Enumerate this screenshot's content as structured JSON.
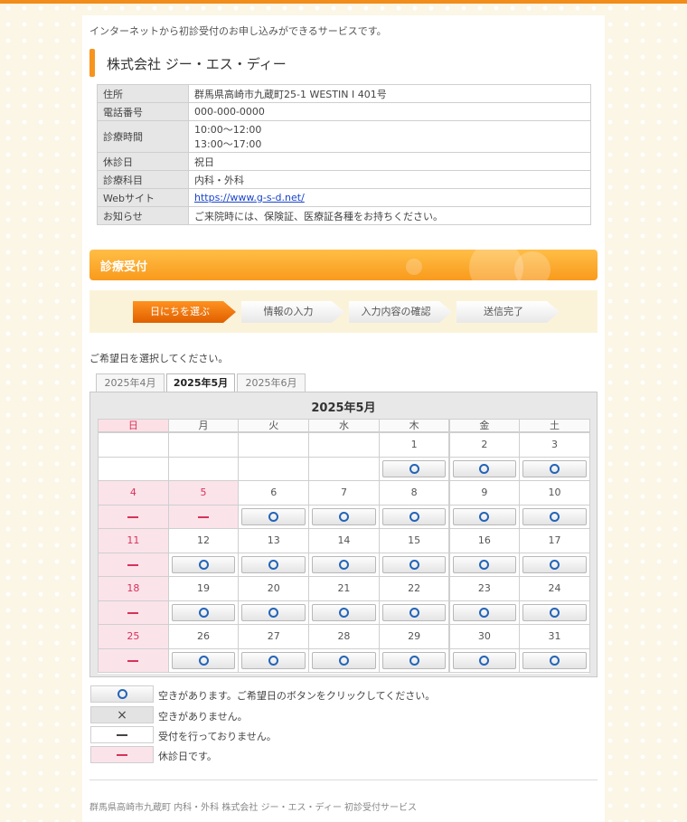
{
  "intro_text": "インターネットから初診受付のお申し込みができるサービスです。",
  "clinic": {
    "name": "株式会社 ジー・エス・ディー",
    "rows": [
      {
        "label": "住所",
        "value": "群馬県高崎市九蔵町25-1 WESTIN Ⅰ 401号"
      },
      {
        "label": "電話番号",
        "value": "000-000-0000"
      },
      {
        "label": "診療時間",
        "value": "10:00～12:00",
        "value2": "13:00～17:00"
      },
      {
        "label": "休診日",
        "value": "祝日"
      },
      {
        "label": "診療科目",
        "value": "内科・外科"
      },
      {
        "label": "Webサイト",
        "value": "https://www.g-s-d.net/"
      },
      {
        "label": "お知らせ",
        "value": "ご来院時には、保険証、医療証各種をお持ちください。"
      }
    ]
  },
  "section_title": "診療受付",
  "steps": [
    "日にちを選ぶ",
    "情報の入力",
    "入力内容の確認",
    "送信完了"
  ],
  "prompt": "ご希望日を選択してください。",
  "tabs": [
    "2025年4月",
    "2025年5月",
    "2025年6月"
  ],
  "calendar": {
    "title": "2025年5月",
    "weekdays": [
      "日",
      "月",
      "火",
      "水",
      "木",
      "金",
      "土"
    ],
    "weeks": [
      [
        null,
        null,
        null,
        null,
        {
          "day": "1",
          "status": "available"
        },
        {
          "day": "2",
          "status": "available"
        },
        {
          "day": "3",
          "status": "available"
        }
      ],
      [
        {
          "day": "4",
          "status": "holiday"
        },
        {
          "day": "5",
          "status": "holiday"
        },
        {
          "day": "6",
          "status": "available"
        },
        {
          "day": "7",
          "status": "available"
        },
        {
          "day": "8",
          "status": "available"
        },
        {
          "day": "9",
          "status": "available"
        },
        {
          "day": "10",
          "status": "available"
        }
      ],
      [
        {
          "day": "11",
          "status": "holiday"
        },
        {
          "day": "12",
          "status": "available"
        },
        {
          "day": "13",
          "status": "available"
        },
        {
          "day": "14",
          "status": "available"
        },
        {
          "day": "15",
          "status": "available"
        },
        {
          "day": "16",
          "status": "available"
        },
        {
          "day": "17",
          "status": "available"
        }
      ],
      [
        {
          "day": "18",
          "status": "holiday"
        },
        {
          "day": "19",
          "status": "available"
        },
        {
          "day": "20",
          "status": "available"
        },
        {
          "day": "21",
          "status": "available"
        },
        {
          "day": "22",
          "status": "available"
        },
        {
          "day": "23",
          "status": "available"
        },
        {
          "day": "24",
          "status": "available"
        }
      ],
      [
        {
          "day": "25",
          "status": "holiday"
        },
        {
          "day": "26",
          "status": "available"
        },
        {
          "day": "27",
          "status": "available"
        },
        {
          "day": "28",
          "status": "available"
        },
        {
          "day": "29",
          "status": "available"
        },
        {
          "day": "30",
          "status": "available"
        },
        {
          "day": "31",
          "status": "available"
        }
      ]
    ]
  },
  "legend": [
    {
      "type": "available",
      "text": "空きがあります。ご希望日のボタンをクリックしてください。"
    },
    {
      "type": "full",
      "text": "空きがありません。"
    },
    {
      "type": "closed",
      "text": "受付を行っておりません。"
    },
    {
      "type": "holiday",
      "text": "休診日です。"
    }
  ],
  "footer": "群馬県高崎市九蔵町 内科・外科 株式会社 ジー・エス・ディー 初診受付サービス",
  "colors": {
    "accent": "#f7941d",
    "holiday": "#d6335a",
    "available_ring": "#2364b8",
    "background": "#fbf6e6"
  }
}
